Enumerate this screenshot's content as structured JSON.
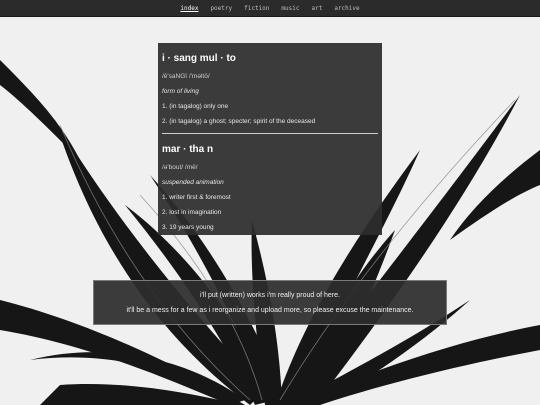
{
  "nav": {
    "items": [
      {
        "label": "index",
        "active": true
      },
      {
        "label": "poetry",
        "active": false
      },
      {
        "label": "fiction",
        "active": false
      },
      {
        "label": "music",
        "active": false
      },
      {
        "label": "art",
        "active": false
      },
      {
        "label": "archive",
        "active": false
      }
    ]
  },
  "entries": [
    {
      "word": "i · sang mul · to",
      "pronunciation": "/ē'saNGī /'məltō/",
      "part": "form of living",
      "definitions": [
        "1. (in tagalog) only one",
        "2. (in tagalog) a ghost; specter; spirit of the deceased"
      ]
    },
    {
      "word": "mar · tha n",
      "pronunciation": "/ə'bout/ /mē/",
      "part": "suspended animation",
      "definitions": [
        "1. writer first & foremost",
        "2. lost in imagination",
        "3. 19 years young"
      ]
    }
  ],
  "notice": {
    "line1": "i'll put (written) works i'm really proud of here.",
    "line2": "it'll be a mess for a few as i reorganize and upload more, so please excuse the maintenance."
  },
  "colors": {
    "nav_bg": "#2b2b2b",
    "panel_bg": "#2d2d2d",
    "background_art": "grayscale plant leaves"
  }
}
